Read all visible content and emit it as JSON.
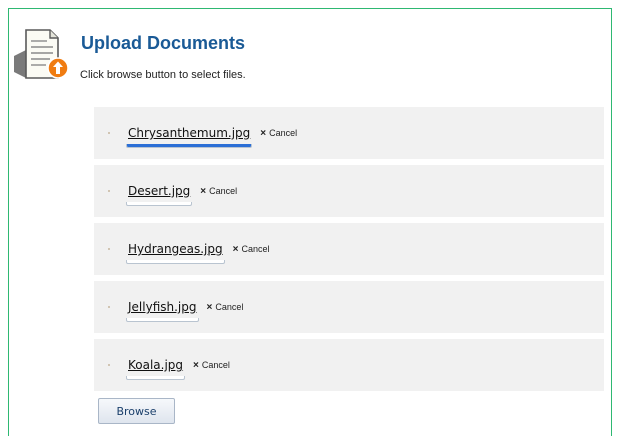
{
  "header": {
    "title": "Upload Documents",
    "subtitle": "Click browse button to select files."
  },
  "files": [
    {
      "name": "Chrysanthemum.jpg",
      "cancel_label": "Cancel",
      "cancel_icon": "×",
      "progress_percent": 100
    },
    {
      "name": "Desert.jpg",
      "cancel_label": "Cancel",
      "cancel_icon": "×",
      "progress_percent": 0
    },
    {
      "name": "Hydrangeas.jpg",
      "cancel_label": "Cancel",
      "cancel_icon": "×",
      "progress_percent": 0
    },
    {
      "name": "Jellyfish.jpg",
      "cancel_label": "Cancel",
      "cancel_icon": "×",
      "progress_percent": 0
    },
    {
      "name": "Koala.jpg",
      "cancel_label": "Cancel",
      "cancel_icon": "×",
      "progress_percent": 0
    }
  ],
  "browse_button": {
    "label": "Browse"
  },
  "colors": {
    "border_accent": "#2eb872",
    "title": "#1a5a96",
    "progress_fill": "#2b6fd6",
    "row_bg": "#f1f1f1",
    "upload_badge": "#f07c11"
  },
  "icons": {
    "header_icon": "document-upload-icon"
  }
}
